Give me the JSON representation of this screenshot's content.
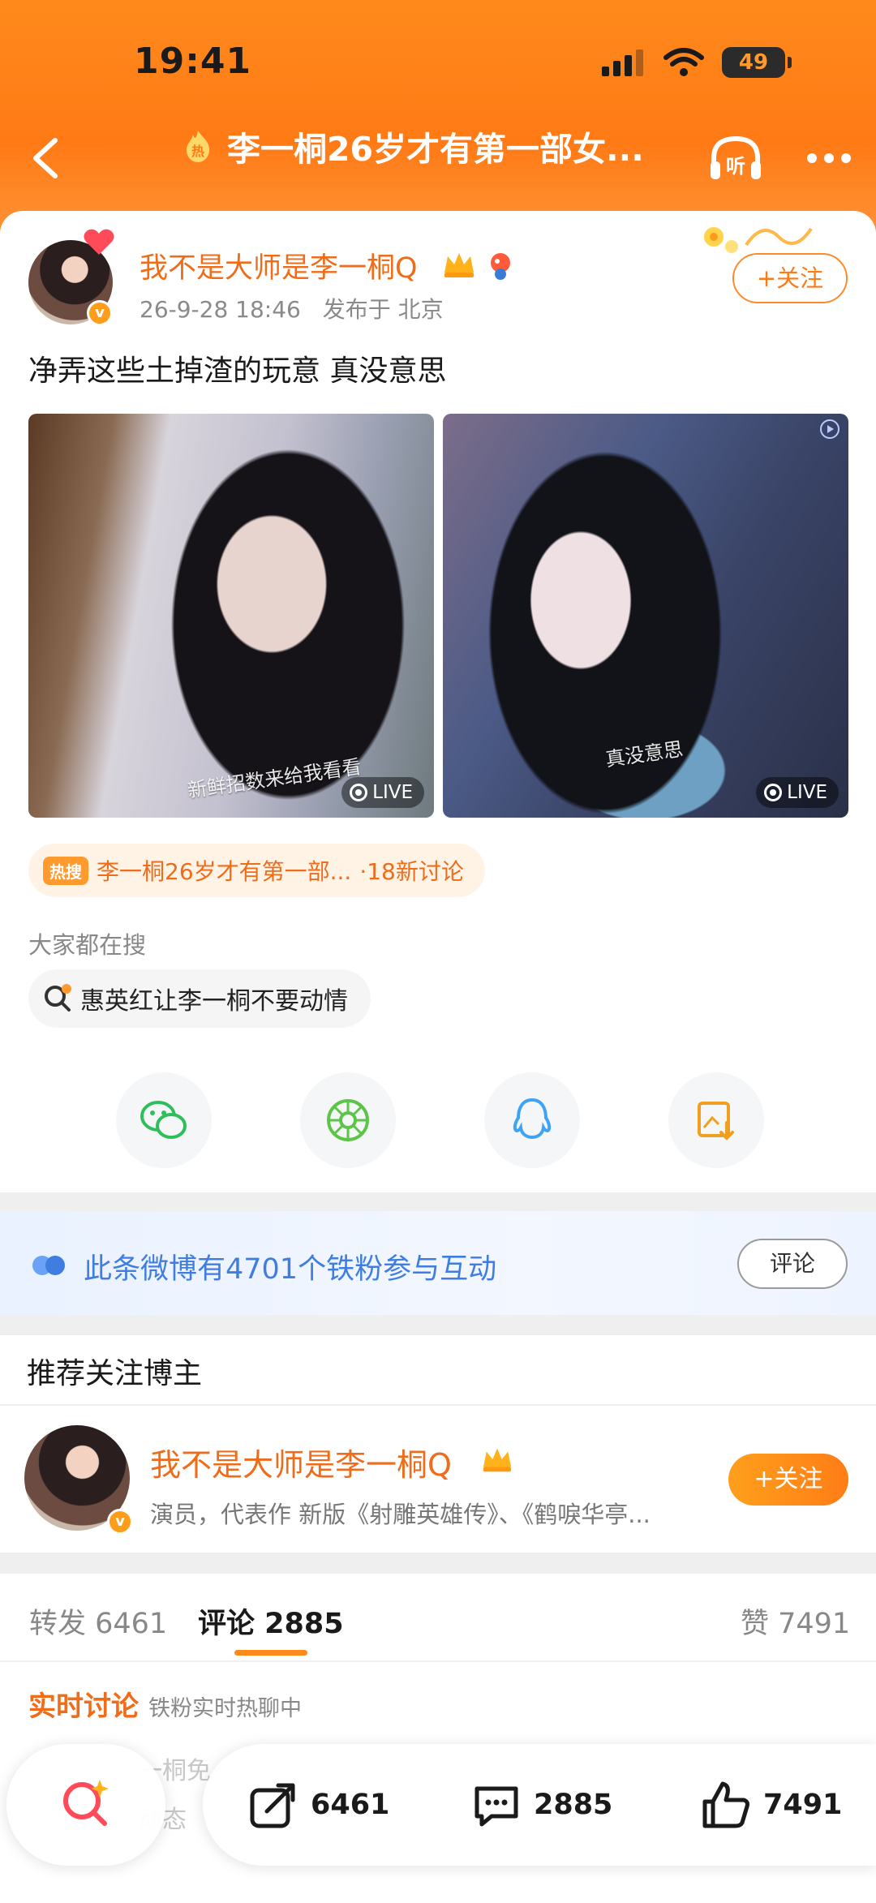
{
  "status_bar": {
    "time": "19:41",
    "battery": "49"
  },
  "nav": {
    "title": "李一桐26岁才有第一部女...",
    "hot_icon": "hot-flame-badge",
    "listen_label": "听"
  },
  "post": {
    "author": "我不是大师是李一桐Q",
    "date": "26-9-28 18:46",
    "location": "发布于 北京",
    "follow_label": "+关注",
    "text": "净弄这些土掉渣的玩意 真没意思",
    "photos": [
      {
        "caption": "新鲜招数来给我看看",
        "tag": "LIVE"
      },
      {
        "caption": "真没意思",
        "tag": "LIVE"
      }
    ],
    "topic": {
      "tag": "热搜",
      "title": "李一桐26岁才有第一部...",
      "count": "·18新讨论"
    },
    "search_section_label": "大家都在搜",
    "search_suggestion": "惠英红让李一桐不要动情",
    "share_icons": [
      "wechat-icon",
      "moments-icon",
      "qq-icon",
      "save-image-icon"
    ]
  },
  "fans": {
    "text": "此条微博有4701个铁粉参与互动",
    "button": "评论"
  },
  "recommend": {
    "title": "推荐关注博主",
    "name": "我不是大师是李一桐Q",
    "desc": "演员，代表作 新版《射雕英雄传》、《鹤唳华亭...",
    "follow_label": "+关注"
  },
  "tabs": {
    "repost": "转发 6461",
    "comment": "评论 2885",
    "like": "赞 7491"
  },
  "live_discussion": {
    "title": "实时讨论",
    "subtitle": "铁粉实时热聊中",
    "ghost1": "一桐免",
    "ghost2": "动态"
  },
  "bottom_actions": {
    "repost": "6461",
    "comment": "2885",
    "like": "7491"
  },
  "colors": {
    "accent": "#ff7a15",
    "brand_orange": "#ef6c1a",
    "link_blue": "#3f7ee0"
  }
}
